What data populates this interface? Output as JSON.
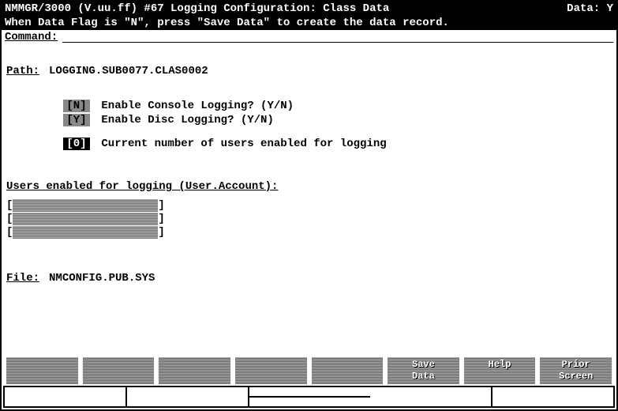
{
  "titlebar": {
    "left": "NMMGR/3000 (V.uu.ff) #67 Logging Configuration: Class Data",
    "right_label": "Data:",
    "right_value": "Y"
  },
  "hint": "When Data Flag is \"N\", press \"Save Data\" to create the data record.",
  "command": {
    "label": "Command:",
    "value": ""
  },
  "path": {
    "label": "Path:",
    "value": "LOGGING.SUB0077.CLAS0002"
  },
  "options": {
    "console": {
      "value": "[N]",
      "text": "Enable Console Logging? (Y/N)"
    },
    "disc": {
      "value": "[Y]",
      "text": "Enable Disc Logging? (Y/N)"
    },
    "users": {
      "value": "[0]",
      "text": "Current number of users enabled for logging"
    }
  },
  "users_section": {
    "label": "Users enabled for logging (User.Account):",
    "fields": [
      "",
      "",
      ""
    ]
  },
  "file": {
    "label": "File:",
    "value": "NMCONFIG.PUB.SYS"
  },
  "fkeys": [
    "",
    "",
    "",
    "",
    "",
    "Save\nData",
    "Help",
    "Prior\nScreen"
  ]
}
